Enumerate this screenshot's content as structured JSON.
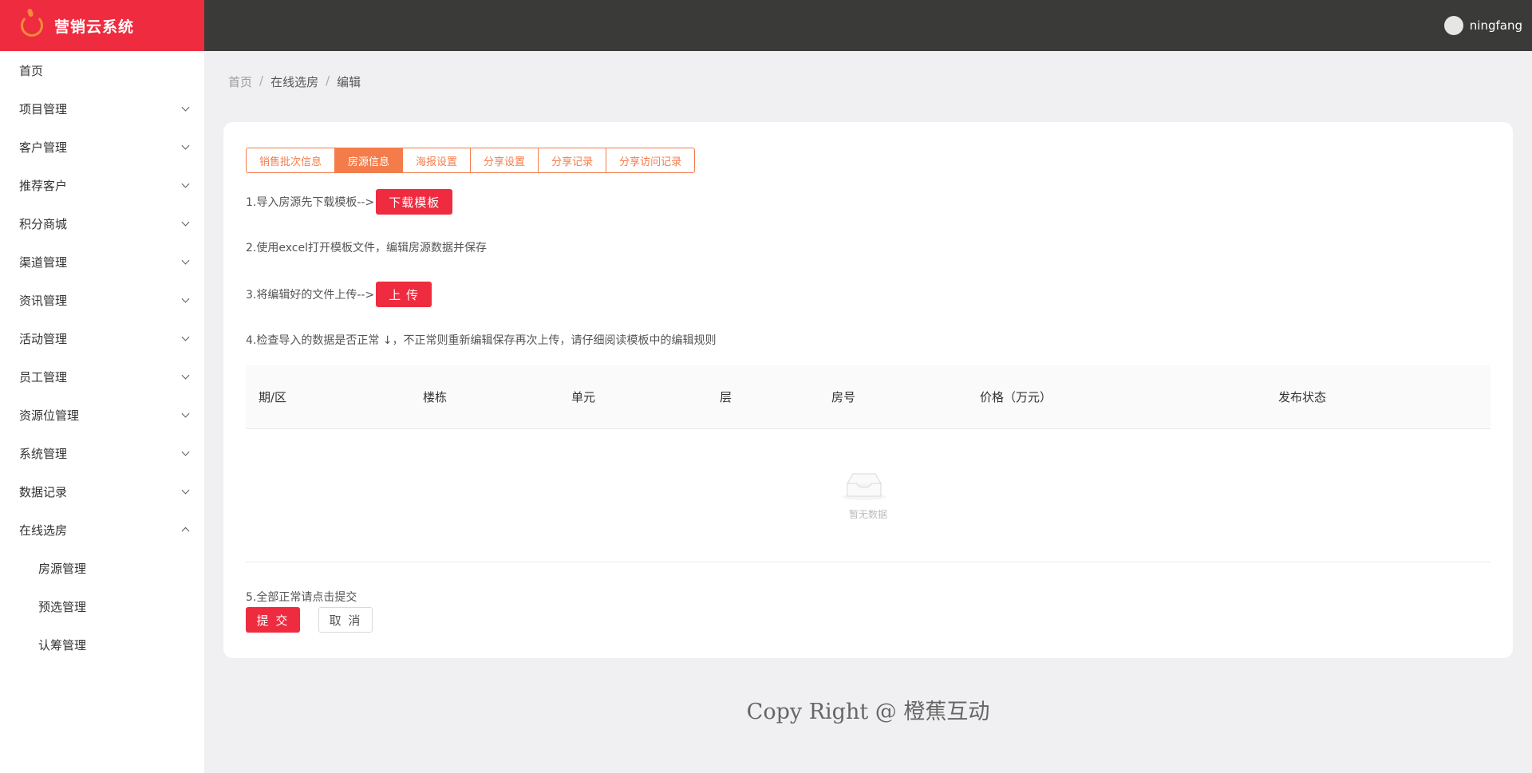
{
  "brand": {
    "title": "营销云系统"
  },
  "user": {
    "name": "ningfang"
  },
  "sidebar": {
    "items": [
      {
        "label": "首页",
        "chevron": "none"
      },
      {
        "label": "项目管理",
        "chevron": "down"
      },
      {
        "label": "客户管理",
        "chevron": "down"
      },
      {
        "label": "推荐客户",
        "chevron": "down"
      },
      {
        "label": "积分商城",
        "chevron": "down"
      },
      {
        "label": "渠道管理",
        "chevron": "down"
      },
      {
        "label": "资讯管理",
        "chevron": "down"
      },
      {
        "label": "活动管理",
        "chevron": "down"
      },
      {
        "label": "员工管理",
        "chevron": "down"
      },
      {
        "label": "资源位管理",
        "chevron": "down"
      },
      {
        "label": "系统管理",
        "chevron": "down"
      },
      {
        "label": "数据记录",
        "chevron": "down"
      },
      {
        "label": "在线选房",
        "chevron": "up"
      }
    ],
    "subitems": [
      {
        "label": "房源管理"
      },
      {
        "label": "预选管理"
      },
      {
        "label": "认筹管理"
      }
    ]
  },
  "breadcrumb": {
    "items": [
      "首页",
      "在线选房",
      "编辑"
    ],
    "separator": "/"
  },
  "tabs": [
    {
      "label": "销售批次信息",
      "active": false
    },
    {
      "label": "房源信息",
      "active": true
    },
    {
      "label": "海报设置",
      "active": false
    },
    {
      "label": "分享设置",
      "active": false
    },
    {
      "label": "分享记录",
      "active": false
    },
    {
      "label": "分享访问记录",
      "active": false
    }
  ],
  "steps": {
    "step1": "1.导入房源先下载模板-->",
    "download_label": "下载模板",
    "step2": "2.使用excel打开模板文件，编辑房源数据并保存",
    "step3": "3.将编辑好的文件上传-->",
    "upload_label": "上 传",
    "step4": "4.检查导入的数据是否正常 ↓，不正常则重新编辑保存再次上传，请仔细阅读模板中的编辑规则",
    "step5": "5.全部正常请点击提交"
  },
  "table": {
    "columns": [
      "期/区",
      "楼栋",
      "单元",
      "层",
      "房号",
      "价格（万元）",
      "发布状态"
    ],
    "empty_text": "暂无数据"
  },
  "actions": {
    "submit_label": "提 交",
    "cancel_label": "取 消"
  },
  "footer": {
    "text": "Copy Right @ 橙蕉互动"
  },
  "colors": {
    "brand_red": "#ef2b3f",
    "tab_orange": "#f47c4b",
    "topbar": "#3a3a38",
    "logo_orange": "#f28c38"
  }
}
